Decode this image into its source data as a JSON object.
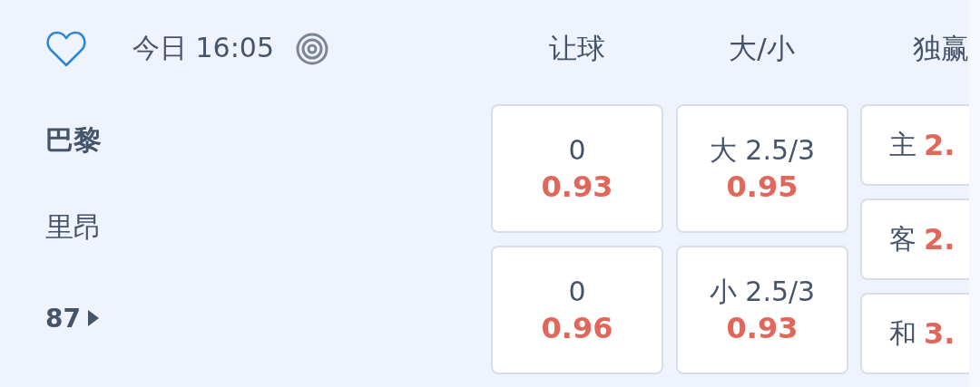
{
  "header": {
    "favorite": false,
    "time": "今日 16:05",
    "columns": [
      "让球",
      "大/小",
      "独赢"
    ]
  },
  "teams": [
    {
      "name": "巴黎",
      "kind": "home"
    },
    {
      "name": "里昂",
      "kind": "away"
    }
  ],
  "more": "87",
  "handicap": [
    {
      "line": "0",
      "odds": "0.93"
    },
    {
      "line": "0",
      "odds": "0.96"
    }
  ],
  "total": [
    {
      "line": "大 2.5/3",
      "odds": "0.95"
    },
    {
      "line": "小 2.5/3",
      "odds": "0.93"
    }
  ],
  "moneyline": [
    {
      "label": "主",
      "odds": "2."
    },
    {
      "label": "客",
      "odds": "2."
    },
    {
      "label": "和",
      "odds": "3."
    }
  ]
}
